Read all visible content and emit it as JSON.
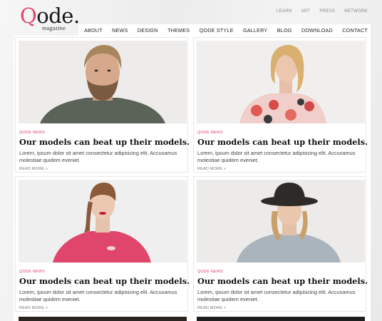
{
  "logo": {
    "q": "Q",
    "rest": "ode.",
    "sub": "magazine"
  },
  "topnav": [
    "LEARN",
    "ART",
    "PRESS",
    "NETWORK"
  ],
  "mainnav": [
    "ABOUT",
    "NEWS",
    "DESIGN",
    "THEMES",
    "QODE STYLE",
    "GALLERY",
    "BLOG",
    "DOWNLOAD",
    "CONTACT"
  ],
  "posts": [
    {
      "category": "QODE NEWS",
      "title": "Our models can beat up their models.",
      "excerpt": "Lorem, ipsum dolor sit amet consectetur adipisicing elit. Accusamus molestiae quidem eveniet.",
      "more": "READ MORE >",
      "image": "man-portrait-beard"
    },
    {
      "category": "QODE NEWS",
      "title": "Our models can beat up their models.",
      "excerpt": "Lorem, ipsum dolor sit amet consectetur adipisicing elit. Accusamus molestiae quidem eveniet.",
      "more": "READ MORE >",
      "image": "woman-floral-blouse"
    },
    {
      "category": "QODE NEWS",
      "title": "Our models can beat up their models.",
      "excerpt": "Lorem, ipsum dolor sit amet consectetur adipisicing elit. Accusamus molestiae quidem eveniet.",
      "more": "READ MORE >",
      "image": "woman-pink-top"
    },
    {
      "category": "QODE NEWS",
      "title": "Our models can beat up their models.",
      "excerpt": "Lorem, ipsum dolor sit amet consectetur adipisicing elit. Accusamus molestiae quidem eveniet.",
      "more": "READ MORE >",
      "image": "woman-black-hat"
    }
  ],
  "colors": {
    "accent": "#e0456b",
    "text": "#111111"
  }
}
